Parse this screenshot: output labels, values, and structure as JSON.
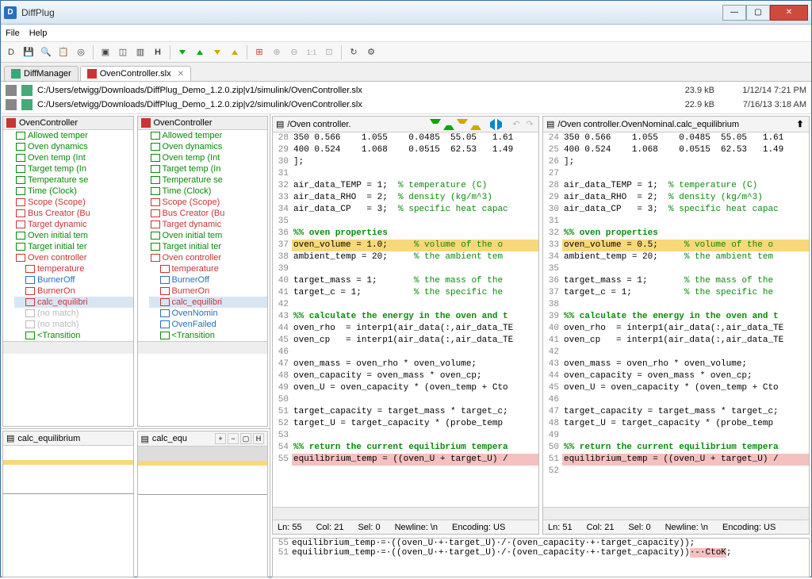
{
  "window_title": "DiffPlug",
  "menu": {
    "file": "File",
    "help": "Help"
  },
  "tabs": {
    "diffmanager": "DiffManager",
    "ovencontroller": "OvenController.slx"
  },
  "files": {
    "left": {
      "path": "C:/Users/etwigg/Downloads/DiffPlug_Demo_1.2.0.zip|v1/simulink/OvenController.slx",
      "size": "23.9 kB",
      "date": "1/12/14 7:21 PM"
    },
    "right": {
      "path": "C:/Users/etwigg/Downloads/DiffPlug_Demo_1.2.0.zip|v2/simulink/OvenController.slx",
      "size": "22.9 kB",
      "date": "7/16/13 3:18 AM"
    }
  },
  "tree": {
    "root": "OvenController",
    "items": [
      {
        "label": "Allowed temper",
        "cls": "green"
      },
      {
        "label": "Oven dynamics",
        "cls": "green"
      },
      {
        "label": "Oven temp (Int",
        "cls": "green"
      },
      {
        "label": "Target temp (In",
        "cls": "green"
      },
      {
        "label": "Temperature se",
        "cls": "green"
      },
      {
        "label": "Time (Clock)",
        "cls": "green"
      },
      {
        "label": "Scope (Scope)",
        "cls": "red"
      },
      {
        "label": "Bus Creator (Bu",
        "cls": "red"
      },
      {
        "label": "Target dynamic",
        "cls": "red"
      },
      {
        "label": "Oven initial tem",
        "cls": "green"
      },
      {
        "label": "Target initial ter",
        "cls": "green"
      },
      {
        "label": "Oven controller",
        "cls": "red"
      },
      {
        "label": "temperature",
        "cls": "red",
        "indent": 1
      },
      {
        "label": "BurnerOff",
        "cls": "blue",
        "indent": 1
      },
      {
        "label": "BurnerOn",
        "cls": "red",
        "indent": 1
      },
      {
        "label": "calc_equilibri",
        "cls": "red",
        "indent": 1,
        "sel": true
      },
      {
        "label": "(no match)",
        "cls": "gray",
        "indent": 1
      },
      {
        "label": "(no match)",
        "cls": "gray",
        "indent": 1
      },
      {
        "label": "<Transition",
        "cls": "green",
        "indent": 1
      }
    ],
    "right_items": [
      {
        "label": "Allowed temper",
        "cls": "green"
      },
      {
        "label": "Oven dynamics",
        "cls": "green"
      },
      {
        "label": "Oven temp (Int",
        "cls": "green"
      },
      {
        "label": "Target temp (In",
        "cls": "green"
      },
      {
        "label": "Temperature se",
        "cls": "green"
      },
      {
        "label": "Time (Clock)",
        "cls": "green"
      },
      {
        "label": "Scope (Scope)",
        "cls": "red"
      },
      {
        "label": "Bus Creator (Bu",
        "cls": "red"
      },
      {
        "label": "Target dynamic",
        "cls": "red"
      },
      {
        "label": "Oven initial tem",
        "cls": "green"
      },
      {
        "label": "Target initial ter",
        "cls": "green"
      },
      {
        "label": "Oven controller",
        "cls": "red"
      },
      {
        "label": "temperature",
        "cls": "red",
        "indent": 1
      },
      {
        "label": "BurnerOff",
        "cls": "blue",
        "indent": 1
      },
      {
        "label": "BurnerOn",
        "cls": "red",
        "indent": 1
      },
      {
        "label": "calc_equilibri",
        "cls": "red",
        "indent": 1,
        "sel": true
      },
      {
        "label": "OvenNomin",
        "cls": "blue",
        "indent": 1
      },
      {
        "label": "OvenFailed",
        "cls": "blue",
        "indent": 1
      },
      {
        "label": "<Transition",
        "cls": "green",
        "indent": 1
      }
    ]
  },
  "minimap": {
    "left_label": "calc_equilibrium",
    "right_label": "calc_equ"
  },
  "panes": {
    "left_title": "/Oven controller.",
    "right_title": "/Oven controller.OvenNominal.calc_equilibrium"
  },
  "code_left": [
    {
      "n": 28,
      "t": "350 0.566    1.055    0.0485  55.05   1.61"
    },
    {
      "n": 29,
      "t": "400 0.524    1.068    0.0515  62.53   1.49"
    },
    {
      "n": 30,
      "t": "];"
    },
    {
      "n": 31,
      "t": ""
    },
    {
      "n": 32,
      "t": "air_data_TEMP = 1;  ",
      "com": "% temperature (C)"
    },
    {
      "n": 33,
      "t": "air_data_RHO  = 2;  ",
      "com": "% density (kg/m^3)"
    },
    {
      "n": 34,
      "t": "air_data_CP   = 3;  ",
      "com": "% specific heat capac"
    },
    {
      "n": 35,
      "t": ""
    },
    {
      "n": 36,
      "t": "",
      "head": "%% oven properties"
    },
    {
      "n": 37,
      "t": "oven_volume = 1.0;     ",
      "com": "% volume of the o",
      "hl": "yel"
    },
    {
      "n": 38,
      "t": "ambient_temp = 20;     ",
      "com": "% the ambient tem"
    },
    {
      "n": 39,
      "t": ""
    },
    {
      "n": 40,
      "t": "target_mass = 1;       ",
      "com": "% the mass of the"
    },
    {
      "n": 41,
      "t": "target_c = 1;          ",
      "com": "% the specific he"
    },
    {
      "n": 42,
      "t": ""
    },
    {
      "n": 43,
      "t": "",
      "head": "%% calculate the energy in the oven and t"
    },
    {
      "n": 44,
      "t": "oven_rho  = interp1(air_data(:,air_data_TE"
    },
    {
      "n": 45,
      "t": "oven_cp   = interp1(air_data(:,air_data_TE"
    },
    {
      "n": 46,
      "t": ""
    },
    {
      "n": 47,
      "t": "oven_mass = oven_rho * oven_volume;"
    },
    {
      "n": 48,
      "t": "oven_capacity = oven_mass * oven_cp;"
    },
    {
      "n": 49,
      "t": "oven_U = oven_capacity * (oven_temp + Cto"
    },
    {
      "n": 50,
      "t": ""
    },
    {
      "n": 51,
      "t": "target_capacity = target_mass * target_c;"
    },
    {
      "n": 52,
      "t": "target_U = target_capacity * (probe_temp"
    },
    {
      "n": 53,
      "t": ""
    },
    {
      "n": 54,
      "t": "",
      "head": "%% return the current equilibrium tempera"
    },
    {
      "n": 55,
      "t": "equilibrium_temp = ((oven_U + target_U) /",
      "hl": "pink"
    }
  ],
  "code_right": [
    {
      "n": 24,
      "t": "350 0.566    1.055    0.0485  55.05   1.61"
    },
    {
      "n": 25,
      "t": "400 0.524    1.068    0.0515  62.53   1.49"
    },
    {
      "n": 26,
      "t": "];"
    },
    {
      "n": 27,
      "t": ""
    },
    {
      "n": 28,
      "t": "air_data_TEMP = 1;  ",
      "com": "% temperature (C)"
    },
    {
      "n": 29,
      "t": "air_data_RHO  = 2;  ",
      "com": "% density (kg/m^3)"
    },
    {
      "n": 30,
      "t": "air_data_CP   = 3;  ",
      "com": "% specific heat capac"
    },
    {
      "n": 31,
      "t": ""
    },
    {
      "n": 32,
      "t": "",
      "head": "%% oven properties"
    },
    {
      "n": 33,
      "t": "oven_volume = 0.5;     ",
      "com": "% volume of the o",
      "hl": "yel"
    },
    {
      "n": 34,
      "t": "ambient_temp = 20;     ",
      "com": "% the ambient tem"
    },
    {
      "n": 35,
      "t": ""
    },
    {
      "n": 36,
      "t": "target_mass = 1;       ",
      "com": "% the mass of the"
    },
    {
      "n": 37,
      "t": "target_c = 1;          ",
      "com": "% the specific he"
    },
    {
      "n": 38,
      "t": ""
    },
    {
      "n": 39,
      "t": "",
      "head": "%% calculate the energy in the oven and t"
    },
    {
      "n": 40,
      "t": "oven_rho  = interp1(air_data(:,air_data_TE"
    },
    {
      "n": 41,
      "t": "oven_cp   = interp1(air_data(:,air_data_TE"
    },
    {
      "n": 42,
      "t": ""
    },
    {
      "n": 43,
      "t": "oven_mass = oven_rho * oven_volume;"
    },
    {
      "n": 44,
      "t": "oven_capacity = oven_mass * oven_cp;"
    },
    {
      "n": 45,
      "t": "oven_U = oven_capacity * (oven_temp + Cto"
    },
    {
      "n": 46,
      "t": ""
    },
    {
      "n": 47,
      "t": "target_capacity = target_mass * target_c;"
    },
    {
      "n": 48,
      "t": "target_U = target_capacity * (probe_temp"
    },
    {
      "n": 49,
      "t": ""
    },
    {
      "n": 50,
      "t": "",
      "head": "%% return the current equilibrium tempera"
    },
    {
      "n": 51,
      "t": "equilibrium_temp = ((oven_U + target_U) /",
      "hl": "pink"
    },
    {
      "n": 52,
      "t": ""
    }
  ],
  "status_left": {
    "ln": "Ln: 55",
    "col": "Col: 21",
    "sel": "Sel: 0",
    "nl": "Newline: \\n",
    "enc": "Encoding: US"
  },
  "status_right": {
    "ln": "Ln: 51",
    "col": "Col: 21",
    "sel": "Sel: 0",
    "nl": "Newline: \\n",
    "enc": "Encoding: US"
  },
  "bottom": [
    {
      "n": 55,
      "t": "equilibrium_temp·=·((oven_U·+·target_U)·/·(oven_capacity·+·target_capacity));"
    },
    {
      "n": 51,
      "t": "equilibrium_temp·=·((oven_U·+·target_U)·/·(oven_capacity·+·target_capacity))",
      "del": "·-·CtoK",
      "tail": ";"
    }
  ]
}
